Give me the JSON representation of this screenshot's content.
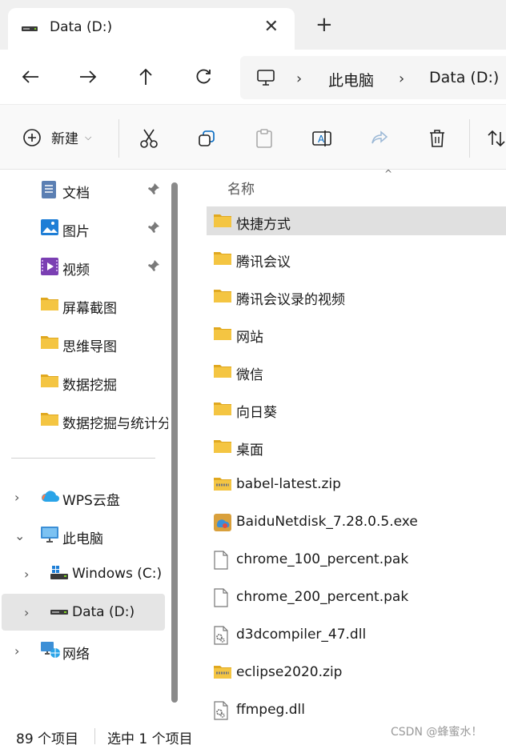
{
  "tab": {
    "title": "Data (D:)",
    "close_glyph": "✕",
    "new_tab_glyph": "+"
  },
  "address": {
    "segments": [
      "此电脑",
      "Data (D:)"
    ]
  },
  "command_bar": {
    "new_label": "新建",
    "new_caret": "⌵"
  },
  "sidebar": {
    "quick": [
      {
        "label": "文档",
        "icon": "document-icon",
        "pinned": true
      },
      {
        "label": "图片",
        "icon": "pictures-icon",
        "pinned": true
      },
      {
        "label": "视频",
        "icon": "video-icon",
        "pinned": true
      },
      {
        "label": "屏幕截图",
        "icon": "folder-icon",
        "pinned": false
      },
      {
        "label": "思维导图",
        "icon": "folder-icon",
        "pinned": false
      },
      {
        "label": "数据挖掘",
        "icon": "folder-icon",
        "pinned": false
      },
      {
        "label": "数据挖掘与统计分",
        "icon": "folder-icon",
        "pinned": false
      }
    ],
    "tree": [
      {
        "label": "WPS云盘",
        "icon": "cloud-icon",
        "expander": "›"
      },
      {
        "label": "此电脑",
        "icon": "pc-icon",
        "expander": "⌄"
      },
      {
        "label": "Windows (C:)",
        "icon": "windows-drive-icon",
        "expander": "›"
      },
      {
        "label": "Data (D:)",
        "icon": "drive-icon",
        "expander": "›",
        "selected": true
      },
      {
        "label": "网络",
        "icon": "network-icon",
        "expander": "›"
      }
    ]
  },
  "filelist": {
    "column_name": "名称",
    "sort_glyph": "^",
    "items": [
      {
        "name": "快捷方式",
        "type": "folder",
        "selected": true
      },
      {
        "name": "腾讯会议",
        "type": "folder"
      },
      {
        "name": "腾讯会议录的视频",
        "type": "folder"
      },
      {
        "name": "网站",
        "type": "folder"
      },
      {
        "name": "微信",
        "type": "folder"
      },
      {
        "name": "向日葵",
        "type": "folder"
      },
      {
        "name": "桌面",
        "type": "folder"
      },
      {
        "name": "babel-latest.zip",
        "type": "zip"
      },
      {
        "name": "BaiduNetdisk_7.28.0.5.exe",
        "type": "exe"
      },
      {
        "name": "chrome_100_percent.pak",
        "type": "file"
      },
      {
        "name": "chrome_200_percent.pak",
        "type": "file"
      },
      {
        "name": "d3dcompiler_47.dll",
        "type": "dll"
      },
      {
        "name": "eclipse2020.zip",
        "type": "zip"
      },
      {
        "name": "ffmpeg.dll",
        "type": "dll"
      }
    ]
  },
  "status": {
    "count": "89 个项目",
    "selection": "选中 1 个项目"
  },
  "watermark": "CSDN @蜂蜜水！",
  "colors": {
    "folder": "#f4c542",
    "folder_dark": "#e0a820",
    "selection": "#e0e0e0",
    "accent": "#0067c0"
  }
}
